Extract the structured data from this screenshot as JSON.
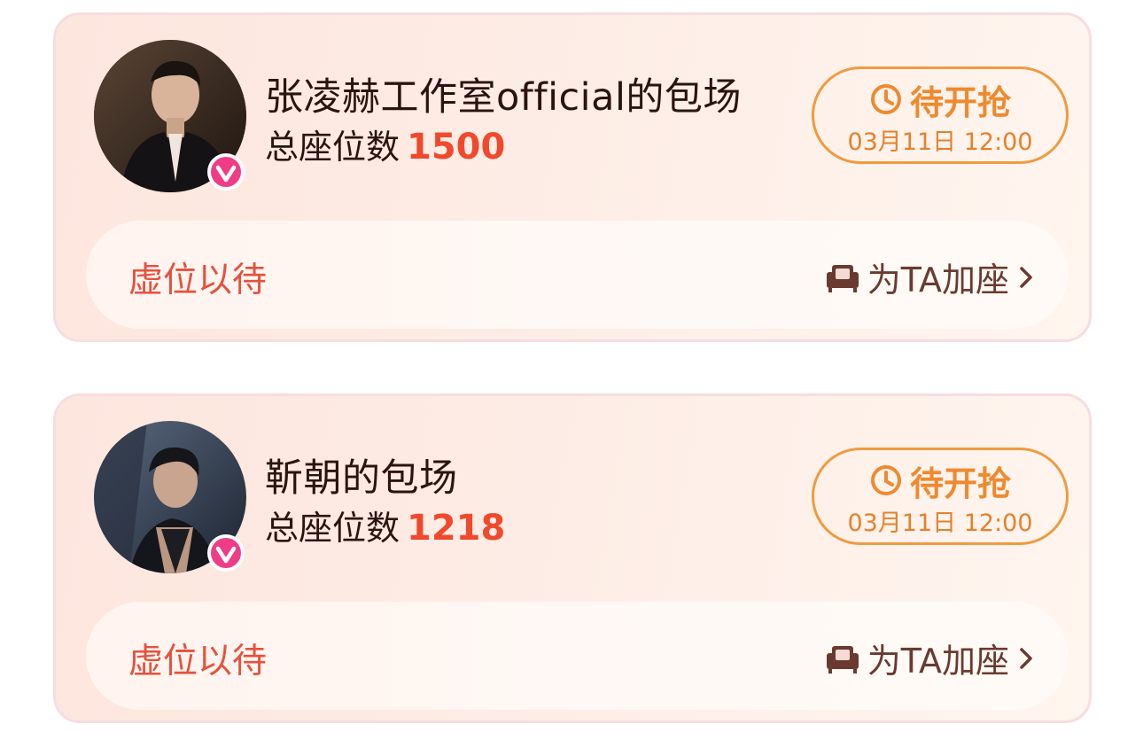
{
  "colors": {
    "accent_red": "#f0492c",
    "accent_orange": "#ee8a2e",
    "badge_pink": "#f03c87",
    "text_dark": "#2b1410"
  },
  "cards": [
    {
      "title": "张凌赫工作室official的包场",
      "seats_label": "总座位数",
      "seats_count": "1500",
      "status": "待开抢",
      "status_icon": "clock-icon",
      "time": "03月11日 12:00",
      "placeholder": "虚位以待",
      "add_seat_label": "为TA加座",
      "add_seat_icon": "sofa-icon",
      "verified_icon": "verified-badge-icon"
    },
    {
      "title": "靳朝的包场",
      "seats_label": "总座位数",
      "seats_count": "1218",
      "status": "待开抢",
      "status_icon": "clock-icon",
      "time": "03月11日 12:00",
      "placeholder": "虚位以待",
      "add_seat_label": "为TA加座",
      "add_seat_icon": "sofa-icon",
      "verified_icon": "verified-badge-icon"
    }
  ]
}
